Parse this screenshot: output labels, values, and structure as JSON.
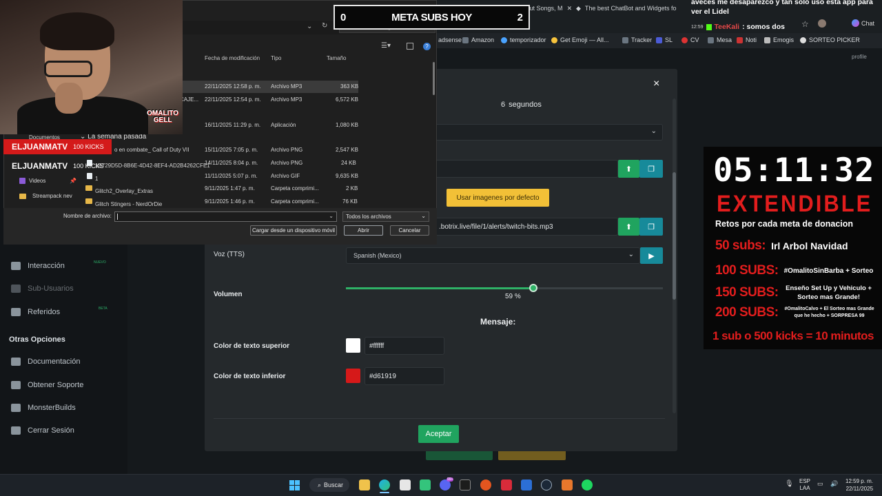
{
  "browser": {
    "tabs": [
      {
        "label": "Online MP3 Cutter - Cut Songs, M"
      },
      {
        "label": "The best ChatBot and Widgets fo"
      }
    ],
    "bookmarks": [
      "adsense",
      "Amazon",
      "temporizador",
      "Get Emoji — All...",
      "Tracker",
      "SL",
      "CV",
      "Mesa",
      "Noti",
      "Emogis",
      "SORTEO PICKER"
    ],
    "chat_label": "Chat"
  },
  "sidebar": {
    "items": [
      {
        "label": "Interacción",
        "badge": "NUEVO"
      },
      {
        "label": "Sub-Usuarios",
        "badge": ""
      },
      {
        "label": "Referidos",
        "badge": "BETA"
      },
      {
        "label": "Documentación",
        "badge": ""
      },
      {
        "label": "Obtener Soporte",
        "badge": ""
      },
      {
        "label": "MonsterBuilds",
        "badge": ""
      },
      {
        "label": "Cerrar Sesión",
        "badge": ""
      }
    ],
    "section_heading": "Otras Opciones",
    "profile_label": "profile"
  },
  "modal": {
    "duration_value": "6",
    "duration_unit": "segundos",
    "default_images_button": "Usar imagenes por defecto",
    "sound_url": ".botrix.live/file/1/alerts/twitch-bits.mp3",
    "voice_label": "Voz (TTS)",
    "voice_value": "Spanish (Mexico)",
    "volume_label": "Volumen",
    "volume_value": 59,
    "volume_text": "59 %",
    "message_heading": "Mensaje:",
    "top_color_label": "Color de texto superior",
    "top_color_value": "#ffffff",
    "bottom_color_label": "Color de texto inferior",
    "bottom_color_value": "#d61919",
    "accept_button": "Aceptar",
    "close_glyph": "×"
  },
  "file_dialog": {
    "search_placeholder": "Buscar en Descargas",
    "columns": [
      "Fecha de modificación",
      "Tipo",
      "Tamaño"
    ],
    "rows": [
      {
        "name": "",
        "date": "22/11/2025 12:58 p. m.",
        "type": "Archivo MP3",
        "size": "363 KB",
        "selected": true
      },
      {
        "name": "CAJE...",
        "date": "22/11/2025 12:54 p. m.",
        "type": "Archivo MP3",
        "size": "6,572 KB"
      },
      {
        "name": "",
        "date": "16/11/2025 11:29 p. m.",
        "type": "Aplicación",
        "size": "1,080 KB"
      },
      {
        "name": "o en combate_ Call of Duty VII",
        "date": "15/11/2025 7:05 p. m.",
        "type": "Archivo PNG",
        "size": "2,547 KB"
      },
      {
        "name": "1B729D5D-8B6E-4D42-8EF4-AD2B4262CFE1",
        "date": "14/11/2025 8:04 p. m.",
        "type": "Archivo PNG",
        "size": "24 KB"
      },
      {
        "name": "1",
        "date": "11/11/2025 5:07 p. m.",
        "type": "Archivo GIF",
        "size": "9,635 KB"
      },
      {
        "name": "Glitch2_Overlay_Extras",
        "date": "9/11/2025 1:47 p. m.",
        "type": "Carpeta comprimi...",
        "size": "2 KB"
      },
      {
        "name": "Glitch Stingers - NerdOrDie",
        "date": "9/11/2025 1:46 p. m.",
        "type": "Carpeta comprimi...",
        "size": "76 KB"
      }
    ],
    "nav_items": [
      "Documentos",
      "La semana pasada",
      "Videos",
      "Streampack nev"
    ],
    "filename_label": "Nombre de archivo:",
    "filter_value": "Todos los archivos",
    "mobile_button": "Cargar desde un dispositivo móvil",
    "open_button": "Abrir",
    "cancel_button": "Cancelar"
  },
  "stream_overlay": {
    "kicks_alerts": [
      {
        "user": "ELJUANMATV",
        "text": "100 KICKS"
      },
      {
        "user": "ELJUANMATV",
        "text": "100 KICKS"
      }
    ],
    "logo_text": "OMALITO GELL",
    "goal": {
      "current": "0",
      "title": "META SUBS HOY",
      "target": "2"
    },
    "chat": {
      "message": "aveces me desaparezco y tan solo uso esta app para ver el Lidel",
      "time": "12:59",
      "user": "TeeKali",
      "text": ": somos dos"
    },
    "timer": "05:11:32",
    "extendible": "EXTENDIBLE",
    "retos_heading": "Retos por cada meta de donacion",
    "goals": [
      {
        "level": "50 subs:",
        "reward": "Irl Arbol Navidad"
      },
      {
        "level": "100 SUBS:",
        "reward": "#OmalitoSinBarba + Sorteo"
      },
      {
        "level": "150 SUBS:",
        "reward": "Enseño Set Up y Vehiculo + Sorteo mas Grande!"
      },
      {
        "level": "200 SUBS:",
        "reward": "#OmalitoCalvo + El Sorteo mas Grande que he hecho + SORPRESA 99"
      }
    ],
    "footer": "1 sub o 500 kicks = 10 minutos"
  },
  "taskbar": {
    "search_label": "Buscar",
    "lang_top": "ESP",
    "lang_bottom": "LAA",
    "time": "12:59 p. m.",
    "date": "22/11/2025",
    "notification_badge": "99+"
  },
  "colors": {
    "accent_green": "#20a45f",
    "accent_teal": "#178a9a",
    "overlay_red": "#e21d1d",
    "yellow_button": "#f2c037"
  }
}
